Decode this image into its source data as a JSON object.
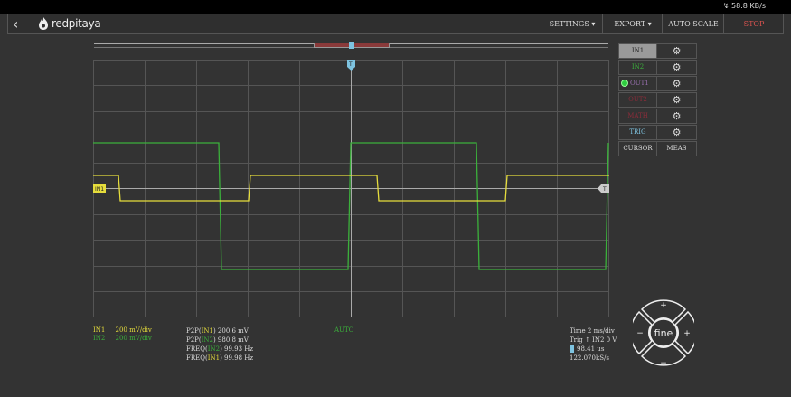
{
  "status_bar": {
    "network": "↯ 58.8 KB/s"
  },
  "nav": {
    "back_icon": "‹",
    "logo_text": "redpitaya",
    "settings": "SETTINGS ▾",
    "export": "EXPORT ▾",
    "autoscale": "AUTO SCALE",
    "stop": "STOP"
  },
  "plot": {
    "in1_marker": "IN1",
    "trig_marker": "T",
    "right_marker": "T",
    "center_label": "AUTO"
  },
  "panel": {
    "in1": "IN1",
    "in2": "IN2",
    "out1": "OUT1",
    "out2": "OUT2",
    "math": "MATH",
    "trig": "TRIG",
    "cursor": "CURSOR",
    "meas": "MEAS"
  },
  "channel_info": {
    "in1_name": "IN1",
    "in1_scale": "200 mV/div",
    "in2_name": "IN2",
    "in2_scale": "200 mV/div"
  },
  "measurements": [
    {
      "pre": "P2P(",
      "ch": "IN1",
      "post": ") 200.6  mV",
      "color": "yellow"
    },
    {
      "pre": "P2P(",
      "ch": "IN2",
      "post": ") 980.8  mV",
      "color": "green"
    },
    {
      "pre": "FREQ(",
      "ch": "IN2",
      "post": ") 99.93  Hz",
      "color": "green"
    },
    {
      "pre": "FREQ(",
      "ch": "IN1",
      "post": ") 99.98  Hz",
      "color": "yellow"
    }
  ],
  "timebase": {
    "time": "Time 2 ms/div",
    "trig": "Trig ↑ IN2 0 V",
    "delay": "98.41 μs",
    "rate": "122.070kS/s"
  },
  "dpad": {
    "center": "fine",
    "up": "+",
    "down": "−",
    "left": "−",
    "right": "+"
  },
  "colors": {
    "in1": "#e6dd3c",
    "in2": "#3bb03b",
    "trig": "#7ec3e0",
    "stop": "#d9534f"
  }
}
